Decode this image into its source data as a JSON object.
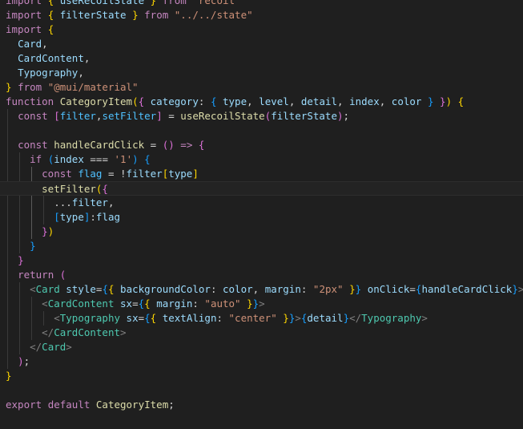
{
  "editor": {
    "language": "javascript",
    "lines": [
      [
        [
          "kw",
          "import"
        ],
        [
          "txt",
          " "
        ],
        [
          "b1",
          "{"
        ],
        [
          "txt",
          " "
        ],
        [
          "var",
          "useRecoilState"
        ],
        [
          "txt",
          " "
        ],
        [
          "b1",
          "}"
        ],
        [
          "txt",
          " "
        ],
        [
          "kw",
          "from"
        ],
        [
          "txt",
          " "
        ],
        [
          "str",
          "\"recoil\""
        ]
      ],
      [
        [
          "kw",
          "import"
        ],
        [
          "txt",
          " "
        ],
        [
          "b1",
          "{"
        ],
        [
          "txt",
          " "
        ],
        [
          "var",
          "filterState"
        ],
        [
          "txt",
          " "
        ],
        [
          "b1",
          "}"
        ],
        [
          "txt",
          " "
        ],
        [
          "kw",
          "from"
        ],
        [
          "txt",
          " "
        ],
        [
          "str",
          "\"../../state\""
        ]
      ],
      [
        [
          "kw",
          "import"
        ],
        [
          "txt",
          " "
        ],
        [
          "b1",
          "{"
        ]
      ],
      [
        [
          "txt",
          "  "
        ],
        [
          "var",
          "Card"
        ],
        [
          "txt",
          ","
        ]
      ],
      [
        [
          "txt",
          "  "
        ],
        [
          "var",
          "CardContent"
        ],
        [
          "txt",
          ","
        ]
      ],
      [
        [
          "txt",
          "  "
        ],
        [
          "var",
          "Typography"
        ],
        [
          "txt",
          ","
        ]
      ],
      [
        [
          "b1",
          "}"
        ],
        [
          "txt",
          " "
        ],
        [
          "kw",
          "from"
        ],
        [
          "txt",
          " "
        ],
        [
          "str",
          "\"@mui/material\""
        ]
      ],
      [
        [
          "kw",
          "function"
        ],
        [
          "txt",
          " "
        ],
        [
          "fn",
          "CategoryItem"
        ],
        [
          "b1",
          "("
        ],
        [
          "b2",
          "{"
        ],
        [
          "txt",
          " "
        ],
        [
          "var",
          "category"
        ],
        [
          "txt",
          ": "
        ],
        [
          "b3",
          "{"
        ],
        [
          "txt",
          " "
        ],
        [
          "var",
          "type"
        ],
        [
          "txt",
          ", "
        ],
        [
          "var",
          "level"
        ],
        [
          "txt",
          ", "
        ],
        [
          "var",
          "detail"
        ],
        [
          "txt",
          ", "
        ],
        [
          "var",
          "index"
        ],
        [
          "txt",
          ", "
        ],
        [
          "var",
          "color"
        ],
        [
          "txt",
          " "
        ],
        [
          "b3",
          "}"
        ],
        [
          "txt",
          " "
        ],
        [
          "b2",
          "}"
        ],
        [
          "b1",
          ")"
        ],
        [
          "txt",
          " "
        ],
        [
          "b1",
          "{"
        ]
      ],
      [
        [
          "txt",
          "  "
        ],
        [
          "kw",
          "const"
        ],
        [
          "txt",
          " "
        ],
        [
          "b2",
          "["
        ],
        [
          "const",
          "filter"
        ],
        [
          "txt",
          ","
        ],
        [
          "const",
          "setFilter"
        ],
        [
          "b2",
          "]"
        ],
        [
          "txt",
          " = "
        ],
        [
          "fn",
          "useRecoilState"
        ],
        [
          "b2",
          "("
        ],
        [
          "var",
          "filterState"
        ],
        [
          "b2",
          ")"
        ],
        [
          "txt",
          ";"
        ]
      ],
      [],
      [
        [
          "txt",
          "  "
        ],
        [
          "kw",
          "const"
        ],
        [
          "txt",
          " "
        ],
        [
          "fn",
          "handleCardClick"
        ],
        [
          "txt",
          " = "
        ],
        [
          "b2",
          "("
        ],
        [
          "b2",
          ")"
        ],
        [
          "txt",
          " "
        ],
        [
          "kw",
          "=>"
        ],
        [
          "txt",
          " "
        ],
        [
          "b2",
          "{"
        ]
      ],
      [
        [
          "txt",
          "    "
        ],
        [
          "ctl",
          "if"
        ],
        [
          "txt",
          " "
        ],
        [
          "b3",
          "("
        ],
        [
          "var",
          "index"
        ],
        [
          "txt",
          " === "
        ],
        [
          "str",
          "'1'"
        ],
        [
          "b3",
          ")"
        ],
        [
          "txt",
          " "
        ],
        [
          "b3",
          "{"
        ]
      ],
      [
        [
          "txt",
          "      "
        ],
        [
          "kw",
          "const"
        ],
        [
          "txt",
          " "
        ],
        [
          "const",
          "flag"
        ],
        [
          "txt",
          " = !"
        ],
        [
          "var",
          "filter"
        ],
        [
          "b1",
          "["
        ],
        [
          "var",
          "type"
        ],
        [
          "b1",
          "]"
        ]
      ],
      [
        [
          "txt",
          "      "
        ],
        [
          "fn",
          "setFilter"
        ],
        [
          "b1",
          "("
        ],
        [
          "b2",
          "{"
        ]
      ],
      [
        [
          "txt",
          "        ..."
        ],
        [
          "var",
          "filter"
        ],
        [
          "txt",
          ","
        ]
      ],
      [
        [
          "txt",
          "        "
        ],
        [
          "b3",
          "["
        ],
        [
          "var",
          "type"
        ],
        [
          "b3",
          "]"
        ],
        [
          "txt",
          ":"
        ],
        [
          "var",
          "flag"
        ]
      ],
      [
        [
          "txt",
          "      "
        ],
        [
          "b2",
          "}"
        ],
        [
          "b1",
          ")"
        ]
      ],
      [
        [
          "txt",
          "    "
        ],
        [
          "b3",
          "}"
        ]
      ],
      [
        [
          "txt",
          "  "
        ],
        [
          "b2",
          "}"
        ]
      ],
      [
        [
          "txt",
          "  "
        ],
        [
          "ctl",
          "return"
        ],
        [
          "txt",
          " "
        ],
        [
          "b2",
          "("
        ]
      ],
      [
        [
          "txt",
          "    "
        ],
        [
          "angle",
          "<"
        ],
        [
          "tag",
          "Card"
        ],
        [
          "txt",
          " "
        ],
        [
          "var",
          "style"
        ],
        [
          "txt",
          "="
        ],
        [
          "b3",
          "{"
        ],
        [
          "b1",
          "{"
        ],
        [
          "txt",
          " "
        ],
        [
          "var",
          "backgroundColor"
        ],
        [
          "txt",
          ": "
        ],
        [
          "var",
          "color"
        ],
        [
          "txt",
          ", "
        ],
        [
          "var",
          "margin"
        ],
        [
          "txt",
          ": "
        ],
        [
          "str",
          "\"2px\""
        ],
        [
          "txt",
          " "
        ],
        [
          "b1",
          "}"
        ],
        [
          "b3",
          "}"
        ],
        [
          "txt",
          " "
        ],
        [
          "var",
          "onClick"
        ],
        [
          "txt",
          "="
        ],
        [
          "b3",
          "{"
        ],
        [
          "var",
          "handleCardClick"
        ],
        [
          "b3",
          "}"
        ],
        [
          "angle",
          ">"
        ]
      ],
      [
        [
          "txt",
          "      "
        ],
        [
          "angle",
          "<"
        ],
        [
          "tag",
          "CardContent"
        ],
        [
          "txt",
          " "
        ],
        [
          "var",
          "sx"
        ],
        [
          "txt",
          "="
        ],
        [
          "b3",
          "{"
        ],
        [
          "b1",
          "{"
        ],
        [
          "txt",
          " "
        ],
        [
          "var",
          "margin"
        ],
        [
          "txt",
          ": "
        ],
        [
          "str",
          "\"auto\""
        ],
        [
          "txt",
          " "
        ],
        [
          "b1",
          "}"
        ],
        [
          "b3",
          "}"
        ],
        [
          "angle",
          ">"
        ]
      ],
      [
        [
          "txt",
          "        "
        ],
        [
          "angle",
          "<"
        ],
        [
          "tag",
          "Typography"
        ],
        [
          "txt",
          " "
        ],
        [
          "var",
          "sx"
        ],
        [
          "txt",
          "="
        ],
        [
          "b3",
          "{"
        ],
        [
          "b1",
          "{"
        ],
        [
          "txt",
          " "
        ],
        [
          "var",
          "textAlign"
        ],
        [
          "txt",
          ": "
        ],
        [
          "str",
          "\"center\""
        ],
        [
          "txt",
          " "
        ],
        [
          "b1",
          "}"
        ],
        [
          "b3",
          "}"
        ],
        [
          "angle",
          ">"
        ],
        [
          "b3",
          "{"
        ],
        [
          "var",
          "detail"
        ],
        [
          "b3",
          "}"
        ],
        [
          "angle",
          "</"
        ],
        [
          "tag",
          "Typography"
        ],
        [
          "angle",
          ">"
        ]
      ],
      [
        [
          "txt",
          "      "
        ],
        [
          "angle",
          "</"
        ],
        [
          "tag",
          "CardContent"
        ],
        [
          "angle",
          ">"
        ]
      ],
      [
        [
          "txt",
          "    "
        ],
        [
          "angle",
          "</"
        ],
        [
          "tag",
          "Card"
        ],
        [
          "angle",
          ">"
        ]
      ],
      [
        [
          "txt",
          "  "
        ],
        [
          "b2",
          ")"
        ],
        [
          "txt",
          ";"
        ]
      ],
      [
        [
          "b1",
          "}"
        ]
      ],
      [],
      [
        [
          "kw",
          "export"
        ],
        [
          "txt",
          " "
        ],
        [
          "kw",
          "default"
        ],
        [
          "txt",
          " "
        ],
        [
          "fn",
          "CategoryItem"
        ],
        [
          "txt",
          ";"
        ]
      ]
    ]
  }
}
